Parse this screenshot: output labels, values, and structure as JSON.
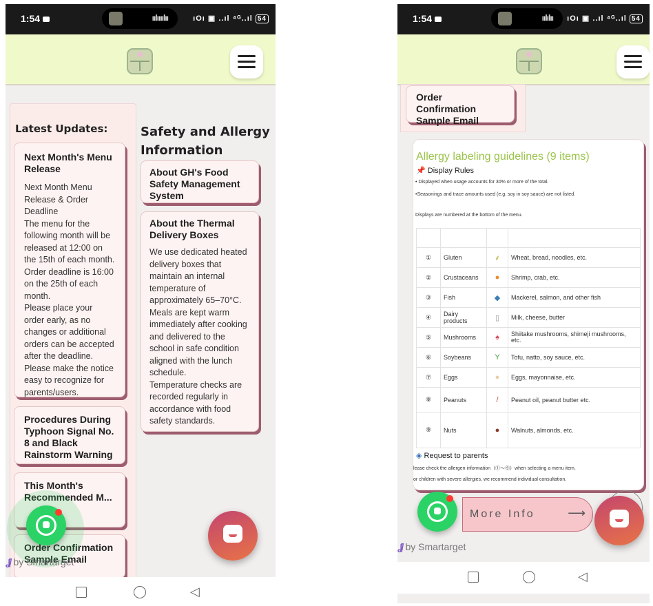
{
  "status": {
    "time": "1:54",
    "left_network_icons": "ıOı ▣ ..ıl ⁴ᴳ..ıl",
    "left_battery": "54",
    "right_network_icons": "ıOı ▣ ..ıl ⁴ᴳ..ıl",
    "right_battery": "54"
  },
  "left": {
    "latest_updates_title": "Latest Updates:",
    "updates": [
      {
        "title": "Next Month's Menu Release",
        "body": "Next Month Menu Release & Order Deadline\nThe menu for the following month will be released at 12:00 on the 15th of each month. Order deadline is 16:00 on the 25th of each month.\nPlease place your order early, as no changes or additional orders can be accepted after the deadline.\nPlease make the notice easy to recognize for parents/users."
      },
      {
        "title": "Procedures During Typhoon Signal No. 8 and Black Rainstorm Warning"
      },
      {
        "title": "This Month's Recommended Menu",
        "visible_title": "This Month's Recommended M..."
      },
      {
        "title": "Order Confirmation Sample Email"
      }
    ],
    "safety_heading": "Safety and Allergy Information",
    "safety_cards": [
      {
        "title": "About GH's Food Safety Management System"
      },
      {
        "title": "About the Thermal Delivery Boxes",
        "body": "We use dedicated heated delivery boxes that maintain an internal temperature of approximately 65–70°C. Meals are kept warm immediately after cooking and delivered to the school in safe condition aligned with the lunch schedule.\nTemperature checks are recorded regularly in accordance with food safety standards."
      }
    ],
    "by_label": "by Smartarget"
  },
  "right": {
    "order_card_title": "Order Confirmation Sample Email",
    "allergy": {
      "title": "Allergy labeling guidelines (9 items)",
      "rules_heading": "Display Rules",
      "rule_1": "• Displayed when usage accounts for 30% or more of the total.",
      "rule_2": "•Seasonings and trace amounts used (e.g. soy in soy sauce) are not listed.",
      "rule_3": "Displays are numbered at the bottom of the menu.",
      "rows": [
        {
          "num": "①",
          "name": "Gluten",
          "icon": "🌾",
          "example": "Wheat, bread, noodles, etc."
        },
        {
          "num": "②",
          "name": "Crustaceans",
          "icon": "🦐",
          "example": "Shrimp, crab, etc."
        },
        {
          "num": "③",
          "name": "Fish",
          "icon": "🐟",
          "example": "Mackerel, salmon, and other fish"
        },
        {
          "num": "④",
          "name": "Dairy products",
          "icon": "🥛",
          "example": "Milk, cheese, butter"
        },
        {
          "num": "⑤",
          "name": "Mushrooms",
          "icon": "🍄",
          "example": "Shiitake mushrooms, shimeji mushrooms, etc."
        },
        {
          "num": "⑥",
          "name": "Soybeans",
          "icon": "🌱",
          "example": "Tofu, natto, soy sauce, etc."
        },
        {
          "num": "⑦",
          "name": "Eggs",
          "icon": "🥚",
          "example": "Eggs, mayonnaise, etc."
        },
        {
          "num": "⑧",
          "name": "Peanuts",
          "icon": "🥜",
          "example": "Peanut oil, peanut butter  etc."
        },
        {
          "num": "⑨",
          "name": "Nuts",
          "icon": "🌰",
          "example": "Walnuts, almonds, etc."
        }
      ],
      "request_heading": "Request to parents",
      "request_1": "lease check the allergen information（①〜⑨）when selecting a menu item.",
      "request_2": "or children with severe allergies, we recommend individual consultation."
    },
    "more_info_label": "More Info",
    "by_label": "by Smartarget"
  },
  "colors": {
    "header_bg": "#eff9c9",
    "card_shadow": "#9d5d6f",
    "allergy_title": "#9bc34a",
    "whatsapp": "#2bd366",
    "more_info_bg": "#f6c6cb"
  }
}
